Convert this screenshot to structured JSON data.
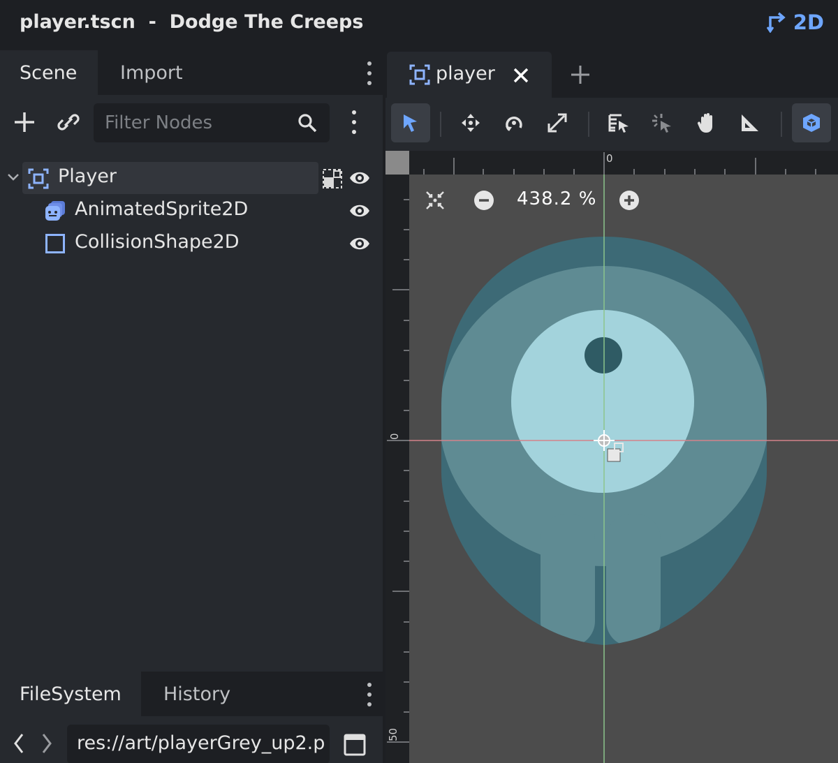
{
  "window": {
    "title": "player.tscn  -  Dodge The Creeps",
    "mode_label": "2D",
    "accent": "#6ea6ff"
  },
  "scene_dock": {
    "tabs": [
      {
        "label": "Scene",
        "active": true
      },
      {
        "label": "Import",
        "active": false
      }
    ],
    "filter_placeholder": "Filter Nodes",
    "nodes": [
      {
        "label": "Player",
        "icon": "node2d-icon",
        "selected": true,
        "expanded": true
      },
      {
        "label": "AnimatedSprite2D",
        "icon": "animated-sprite-icon",
        "selected": false
      },
      {
        "label": "CollisionShape2D",
        "icon": "collision-shape-icon",
        "selected": false
      }
    ]
  },
  "filesystem_dock": {
    "tabs": [
      {
        "label": "FileSystem",
        "active": true
      },
      {
        "label": "History",
        "active": false
      }
    ],
    "path": "res://art/playerGrey_up2.p"
  },
  "editor": {
    "scene_tab_label": "player",
    "zoom_label": "438.2 %",
    "ruler": {
      "h_zero_label": "0",
      "v_zero_label": "0",
      "v_50_label": "50"
    }
  }
}
